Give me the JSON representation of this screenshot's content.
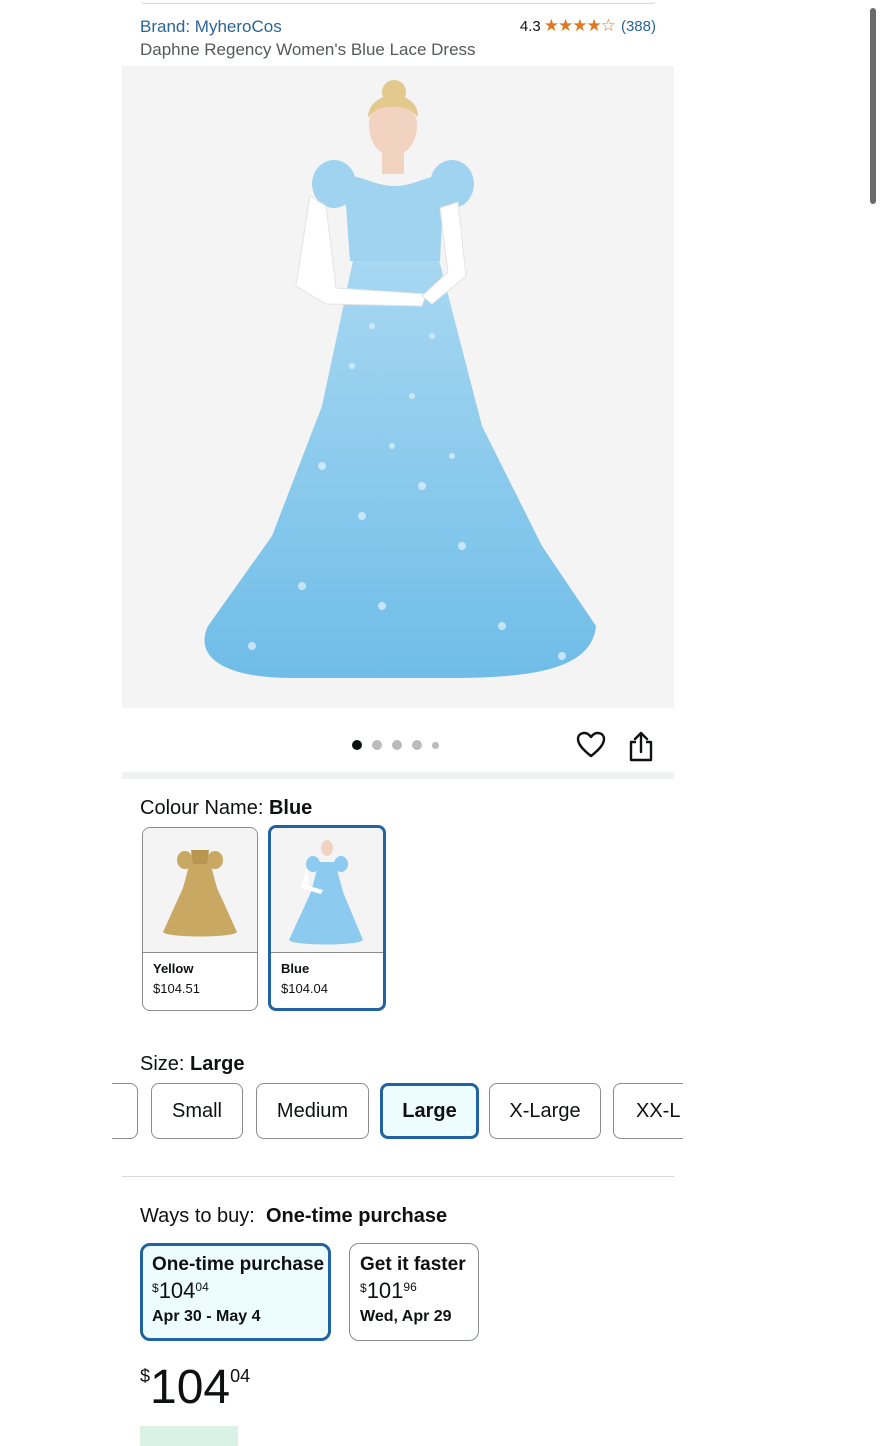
{
  "product": {
    "brand": "Brand: MyheroCos",
    "title": "Daphne Regency Women's Blue Lace Dress",
    "rating_value": "4.3",
    "rating_stars": "★★★★☆",
    "rating_count": "(388)"
  },
  "gallery": {
    "image_count": 5,
    "active_index": 0
  },
  "colour": {
    "label": "Colour Name:",
    "selected": "Blue",
    "options": [
      {
        "name": "Yellow",
        "price": "$104.51"
      },
      {
        "name": "Blue",
        "price": "$104.04"
      }
    ]
  },
  "size": {
    "label": "Size:",
    "selected": "Large",
    "options": [
      "Small",
      "Medium",
      "Large",
      "X-Large",
      "XX-L"
    ]
  },
  "ways_to_buy": {
    "label": "Ways to buy:",
    "selected": "One-time purchase",
    "options": [
      {
        "title": "One-time purchase",
        "currency": "$",
        "whole": "104",
        "cents": "04",
        "delivery": "Apr 30 - May 4"
      },
      {
        "title": "Get it faster",
        "currency": "$",
        "whole": "101",
        "cents": "96",
        "delivery": "Wed, Apr 29"
      }
    ]
  },
  "price": {
    "currency": "$",
    "whole": "104",
    "cents": "04"
  },
  "colors": {
    "link": "#2a6496",
    "star": "#de7921",
    "selected_border": "#2162a1",
    "selected_bg": "#edfdff",
    "dress_blue": "#7cc4ec"
  }
}
